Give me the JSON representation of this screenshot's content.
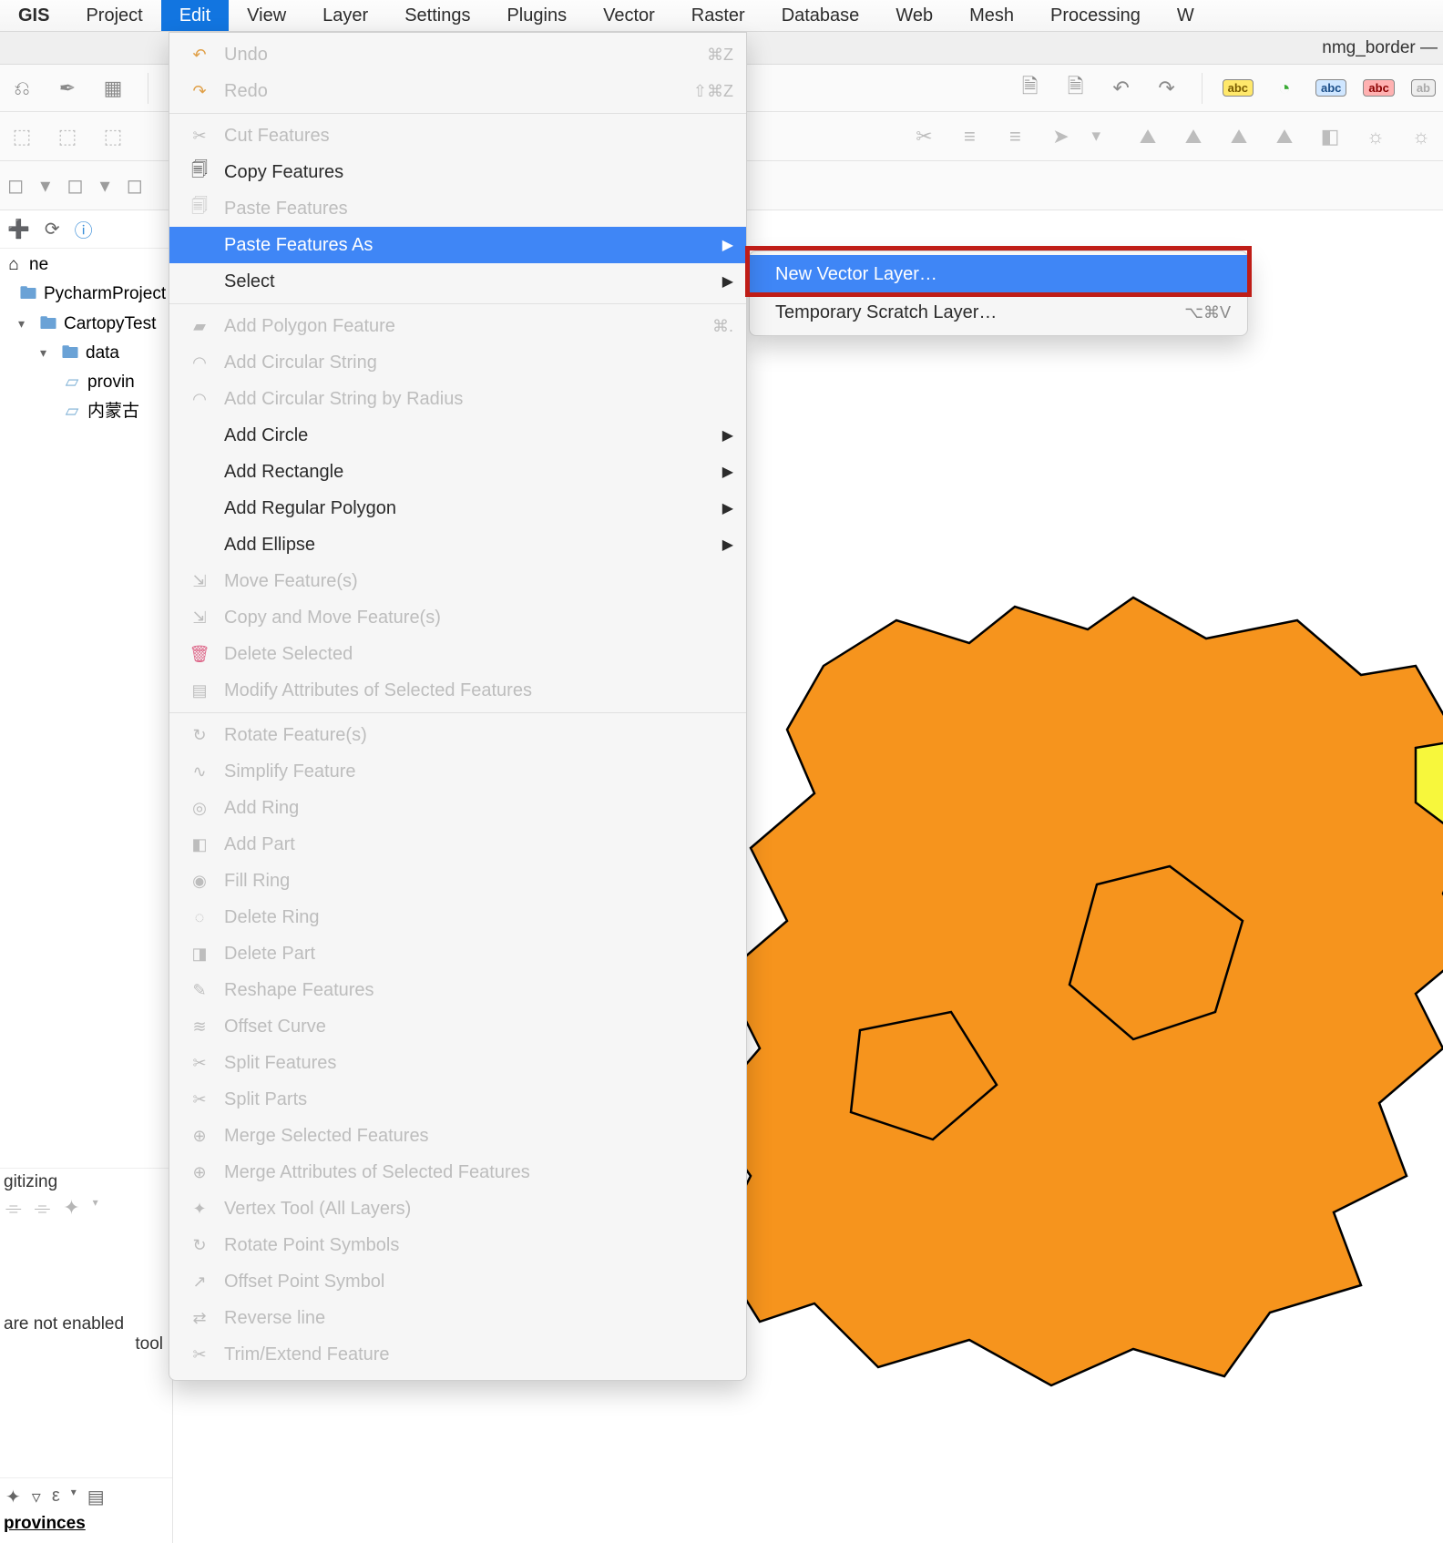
{
  "menubar": {
    "items": [
      "GIS",
      "Project",
      "Edit",
      "View",
      "Layer",
      "Settings",
      "Plugins",
      "Vector",
      "Raster",
      "Database",
      "Web",
      "Mesh",
      "Processing",
      "W"
    ],
    "open_index": 2
  },
  "window": {
    "title": "nmg_border —"
  },
  "edit_menu": {
    "undo": "Undo",
    "undo_sc": "⌘Z",
    "redo": "Redo",
    "redo_sc": "⇧⌘Z",
    "cut": "Cut Features",
    "copy": "Copy Features",
    "paste": "Paste Features",
    "paste_as": "Paste Features As",
    "select": "Select",
    "add_polygon": "Add Polygon Feature",
    "add_polygon_sc": "⌘.",
    "add_circ_string": "Add Circular String",
    "add_circ_radius": "Add Circular String by Radius",
    "add_circle": "Add Circle",
    "add_rect": "Add Rectangle",
    "add_regpoly": "Add Regular Polygon",
    "add_ellipse": "Add Ellipse",
    "move": "Move Feature(s)",
    "copymove": "Copy and Move Feature(s)",
    "delete_sel": "Delete Selected",
    "modify_attrs": "Modify Attributes of Selected Features",
    "rotate": "Rotate Feature(s)",
    "simplify": "Simplify Feature",
    "add_ring": "Add Ring",
    "add_part": "Add Part",
    "fill_ring": "Fill Ring",
    "delete_ring": "Delete Ring",
    "delete_part": "Delete Part",
    "reshape": "Reshape Features",
    "offset_curve": "Offset Curve",
    "split_feat": "Split Features",
    "split_parts": "Split Parts",
    "merge_sel": "Merge Selected Features",
    "merge_attrs": "Merge Attributes of Selected Features",
    "vertex_tool": "Vertex Tool (All Layers)",
    "rotate_pts": "Rotate Point Symbols",
    "offset_pts": "Offset Point Symbol",
    "reverse_line": "Reverse line",
    "trim_extend": "Trim/Extend Feature"
  },
  "submenu": {
    "new_vector": "New Vector Layer…",
    "scratch": "Temporary Scratch Layer…",
    "scratch_sc": "⌥⌘V"
  },
  "browser": {
    "home_label": "ne",
    "items": [
      {
        "label": "PycharmProject"
      },
      {
        "label": "CartopyTest"
      },
      {
        "label": "data"
      },
      {
        "label": "provin"
      },
      {
        "label": "内蒙古"
      }
    ]
  },
  "digitizing": {
    "title": "gitizing",
    "msg1": "are not enabled",
    "msg2": "tool"
  },
  "layers": {
    "selected": "provinces"
  }
}
